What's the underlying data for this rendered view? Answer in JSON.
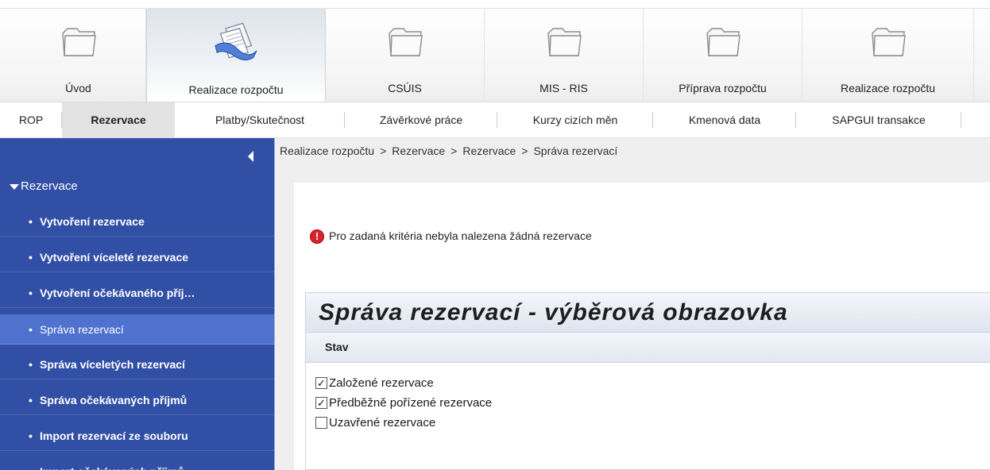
{
  "top_tabs": [
    {
      "label": "Úvod",
      "icon": "folder-icon",
      "active": false
    },
    {
      "label": "Realizace rozpočtu",
      "icon": "documents-icon",
      "active": true
    },
    {
      "label": "CSÚIS",
      "icon": "folder-icon",
      "active": false
    },
    {
      "label": "MIS - RIS",
      "icon": "folder-icon",
      "active": false
    },
    {
      "label": "Příprava rozpočtu",
      "icon": "folder-icon",
      "active": false
    },
    {
      "label": "Realizace rozpočtu",
      "icon": "folder-icon",
      "active": false
    }
  ],
  "sub_tabs": [
    {
      "label": "ROP",
      "active": false
    },
    {
      "label": "Rezervace",
      "active": true
    },
    {
      "label": "Platby/Skutečnost",
      "active": false
    },
    {
      "label": "Závěrkové práce",
      "active": false
    },
    {
      "label": "Kurzy cizích měn",
      "active": false
    },
    {
      "label": "Kmenová data",
      "active": false
    },
    {
      "label": "SAPGUI transakce",
      "active": false
    }
  ],
  "sidebar": {
    "section": "Rezervace",
    "items": [
      {
        "label": "Vytvoření rezervace",
        "selected": false
      },
      {
        "label": "Vytvoření víceleté rezervace",
        "selected": false
      },
      {
        "label": "Vytvoření očekávaného příj…",
        "selected": false
      },
      {
        "label": "Správa rezervací",
        "selected": true
      },
      {
        "label": "Správa víceletých rezervací",
        "selected": false
      },
      {
        "label": "Správa očekávaných příjmů",
        "selected": false
      },
      {
        "label": "Import rezervací ze souboru",
        "selected": false
      },
      {
        "label": "Import očekávaných příjmů",
        "selected": false
      }
    ]
  },
  "breadcrumb": {
    "items": [
      "Realizace rozpočtu",
      "Rezervace",
      "Rezervace",
      "Správa rezervací"
    ],
    "separator": ">"
  },
  "message": {
    "text": "Pro zadaná kritéria nebyla nalezena žádná rezervace",
    "icon": "error-icon"
  },
  "form": {
    "title": "Správa rezervací - výběrová obrazovka",
    "section_label": "Stav",
    "checkboxes": [
      {
        "label": "Založené rezervace",
        "checked": true
      },
      {
        "label": "Předběžně pořízené rezervace",
        "checked": true
      },
      {
        "label": "Uzavřené rezervace",
        "checked": false
      }
    ]
  },
  "colors": {
    "sidebar_bg": "#324fa6",
    "sidebar_selected": "#4f72cf",
    "error_red": "#d9232d"
  }
}
